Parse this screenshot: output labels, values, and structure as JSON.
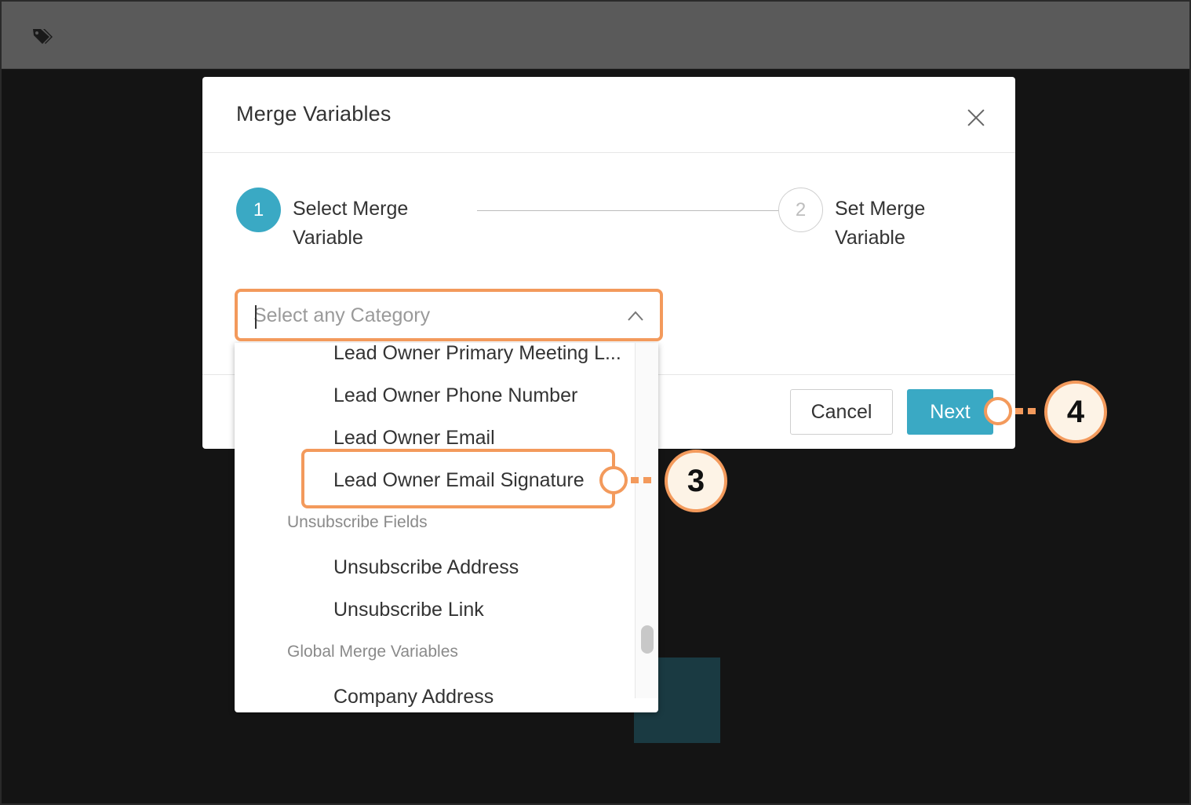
{
  "modal": {
    "title": "Merge Variables",
    "steps": [
      {
        "number": "1",
        "label": "Select Merge Variable",
        "state": "active"
      },
      {
        "number": "2",
        "label": "Set Merge Variable",
        "state": "inactive"
      }
    ],
    "cancel_label": "Cancel",
    "next_label": "Next"
  },
  "category_select": {
    "placeholder": "Select any Category"
  },
  "dropdown": {
    "items": [
      {
        "type": "option",
        "label": "Lead Owner Primary Meeting L..."
      },
      {
        "type": "option",
        "label": "Lead Owner Phone Number"
      },
      {
        "type": "option",
        "label": "Lead Owner Email"
      },
      {
        "type": "option",
        "label": "Lead Owner Email Signature",
        "highlighted": true
      },
      {
        "type": "group",
        "label": "Unsubscribe Fields"
      },
      {
        "type": "option",
        "label": "Unsubscribe Address"
      },
      {
        "type": "option",
        "label": "Unsubscribe Link"
      },
      {
        "type": "group",
        "label": "Global Merge Variables"
      },
      {
        "type": "option",
        "label": "Company Address"
      }
    ]
  },
  "callouts": [
    {
      "number": "3",
      "target": "Lead Owner Email Signature"
    },
    {
      "number": "4",
      "target": "Next"
    }
  ],
  "colors": {
    "accent": "#3aa9c4",
    "callout": "#f39a5c",
    "overlay": "#141414",
    "topbar": "#5a5a5a"
  },
  "icons": {
    "topbar": "tag-icon",
    "close": "close-icon",
    "select": "chevron-up-icon"
  }
}
